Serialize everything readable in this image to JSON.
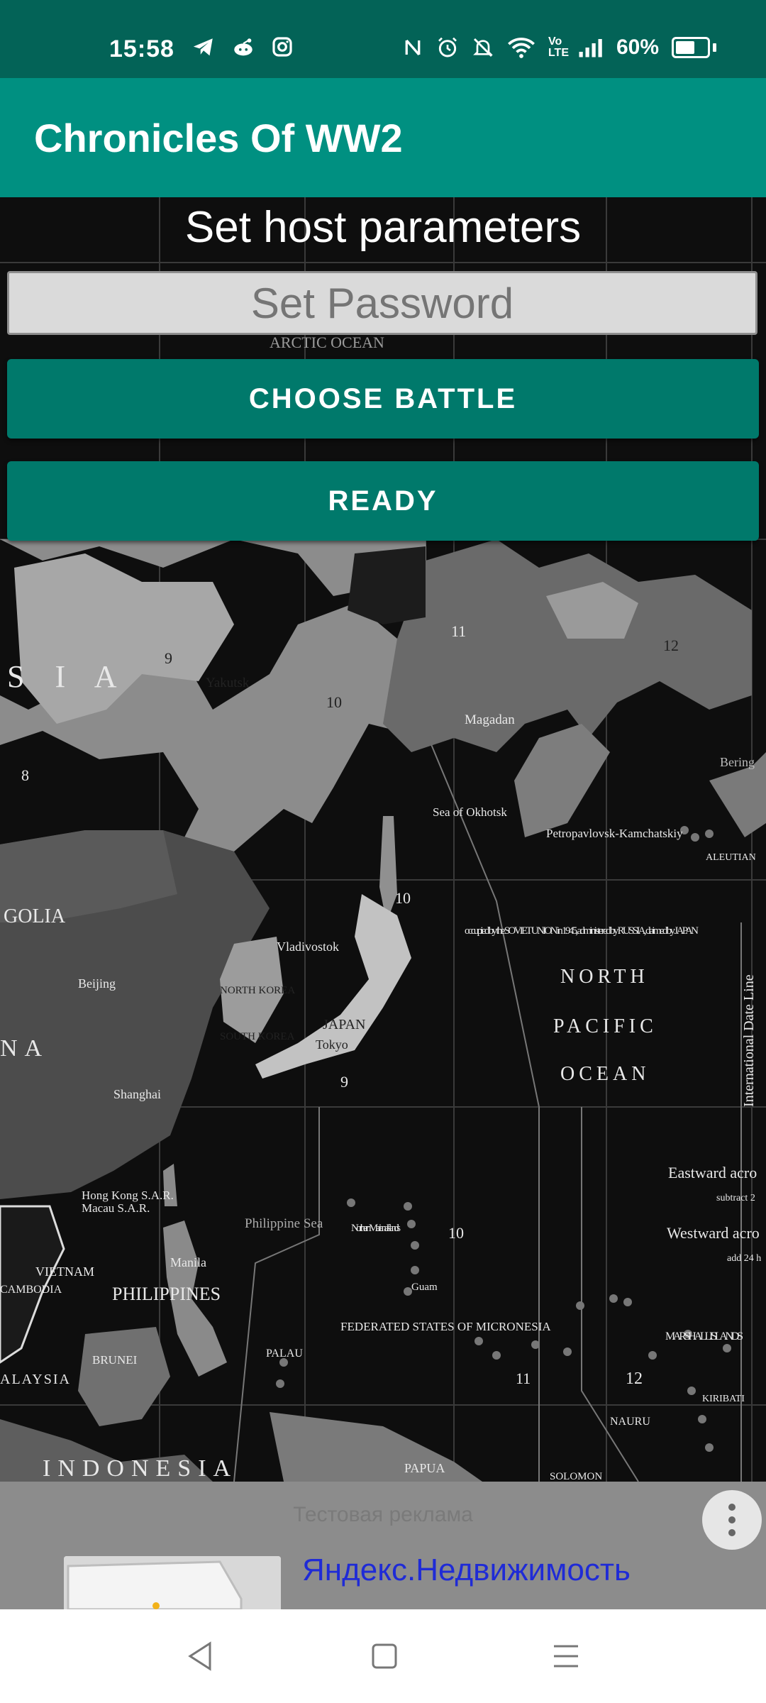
{
  "status_bar": {
    "time": "15:58",
    "left_icons": [
      "telegram-icon",
      "reddit-icon",
      "instagram-icon"
    ],
    "right_icons": [
      "nfc-icon",
      "alarm-icon",
      "mute-icon",
      "wifi-icon",
      "volte-icon",
      "signal-icon"
    ],
    "network_label": "Vo LTE",
    "battery": "60%"
  },
  "app_bar": {
    "title": "Chronicles Of WW2",
    "color": "#009081"
  },
  "host": {
    "title": "Set host parameters",
    "password_placeholder": "Set Password",
    "choose_battle_label": "CHOOSE BATTLE",
    "ready_label": "READY",
    "button_color": "#00796b"
  },
  "map": {
    "labels": {
      "arctic": "ARCTIC OCEAN",
      "asia": "S I A",
      "yakutsk": "Yakutsk",
      "magadan": "Magadan",
      "okhotsk": "Sea of Okhotsk",
      "petropavlovsk": "Petropavlovsk-Kamchatskiy",
      "mongolia": "GOLIA",
      "china": "NA",
      "beijing": "Beijing",
      "vladivostok": "Vladivostok",
      "north_korea": "NORTH KOREA",
      "south_korea": "SOUTH KOREA",
      "japan": "JAPAN",
      "tokyo": "Tokyo",
      "shanghai": "Shanghai",
      "kuril_note": "occupied by the SOVIET UNION in 1945, administered by RUSSIA, claimed by JAPAN",
      "north_pacific_1": "NORTH",
      "north_pacific_2": "PACIFIC",
      "north_pacific_3": "OCEAN",
      "date_line": "International Date Line",
      "hong_kong": "Hong Kong S.A.R.",
      "macau": "Macau S.A.R.",
      "philippine_sea": "Philippine Sea",
      "mariana": "Northern Mariana Islands",
      "guam": "Guam",
      "vietnam": "VIETNAM",
      "cambodia": "CAMBODIA",
      "manila": "Manila",
      "philippines": "PHILIPPINES",
      "micronesia": "FEDERATED STATES OF MICRONESIA",
      "palau": "PALAU",
      "brunei": "BRUNEI",
      "malaysia": "ALAYSIA",
      "marshall": "MARSHALL ISLANDS",
      "nauru": "NAURU",
      "kiribati": "KIRIBATI",
      "indonesia": "INDONESIA",
      "papua": "PAPUA",
      "solomon": "SOLOMON",
      "eastward": "Eastward acro",
      "westward": "Westward acro",
      "subtract": "subtract 2",
      "add24": "add 24 h",
      "bering": "Bering",
      "aleutian": "ALEUTIAN",
      "zone_8": "8",
      "zone_9a": "9",
      "zone_9b": "9",
      "zone_10a": "10",
      "zone_10b": "10",
      "zone_10c": "10",
      "zone_11a": "11",
      "zone_11b": "11",
      "zone_12a": "12",
      "zone_12b": "12"
    }
  },
  "ad": {
    "label": "Тестовая реклама",
    "link_text": "Яндекс.Недвижимость",
    "menu_icon": "more-vert-icon"
  },
  "nav_bar": {
    "icons": [
      "back-icon",
      "home-icon",
      "menu-icon"
    ]
  }
}
